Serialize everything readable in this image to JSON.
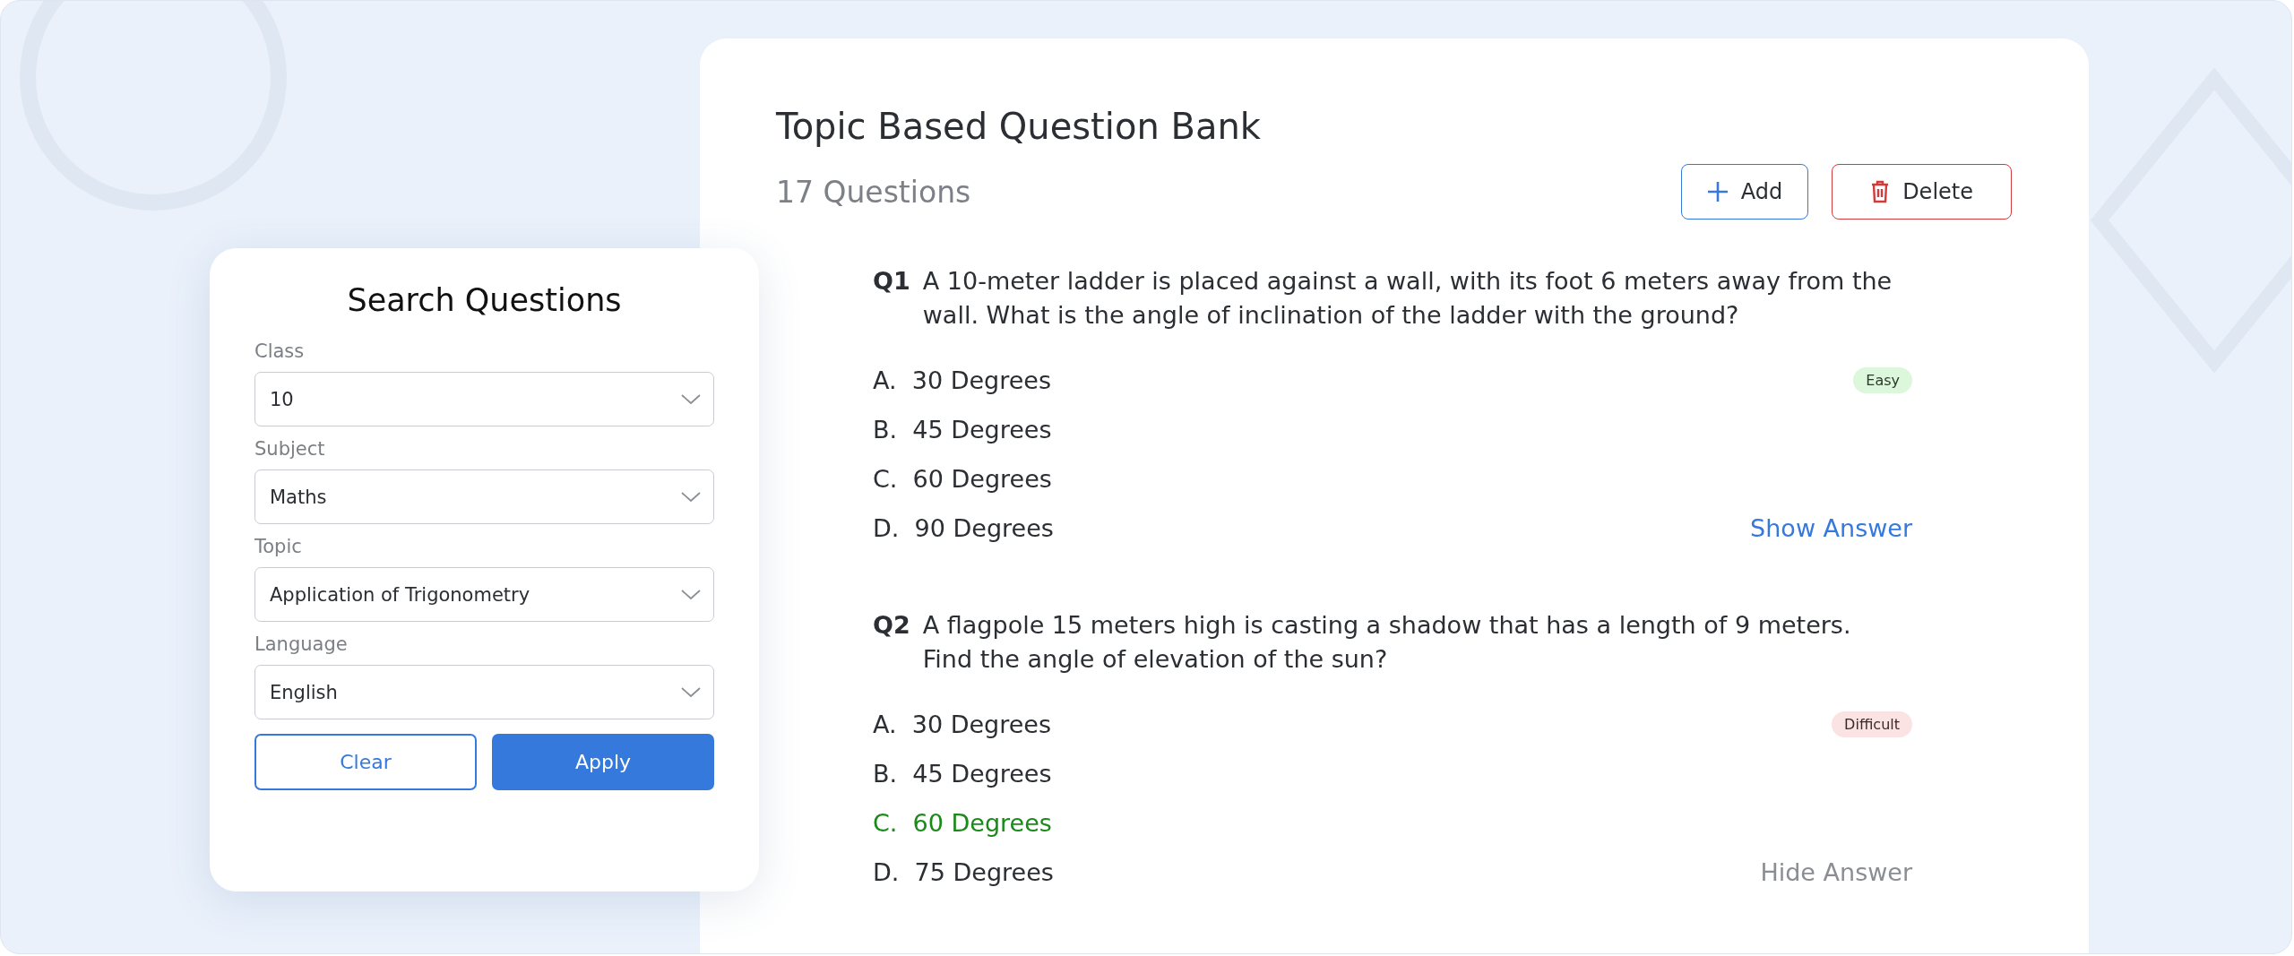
{
  "search_panel": {
    "title": "Search Questions",
    "fields": [
      {
        "label": "Class",
        "value": "10"
      },
      {
        "label": "Subject",
        "value": "Maths"
      },
      {
        "label": "Topic",
        "value": "Application of Trigonometry"
      },
      {
        "label": "Language",
        "value": "English"
      }
    ],
    "buttons": [
      {
        "label": "Clear",
        "kind": "outline"
      },
      {
        "label": "Apply",
        "kind": "primary"
      }
    ]
  },
  "bank": {
    "title": "Topic Based Question Bank",
    "count": "17 Questions",
    "actions": [
      {
        "label": "Add",
        "kind": "add"
      },
      {
        "label": "Delete",
        "kind": "delete"
      }
    ],
    "questions": [
      {
        "number": "Q1",
        "text": "A 10-meter ladder is placed against a wall, with its foot 6 meters away from the wall. What is the angle of inclination of the ladder with the ground?",
        "difficulty": {
          "label": "Easy",
          "kind": "easy"
        },
        "answer_visible": false,
        "toggle": "Show Answer",
        "options": [
          {
            "label": "A.  30 Degrees",
            "highlighted": false
          },
          {
            "label": "B.  45 Degrees",
            "highlighted": false
          },
          {
            "label": "C.  60 Degrees",
            "highlighted": false
          },
          {
            "label": "D.  90 Degrees",
            "highlighted": false
          }
        ]
      },
      {
        "number": "Q2",
        "text": "A flagpole 15 meters high is casting a shadow that has a length of 9 meters. Find the angle of elevation of the sun?",
        "difficulty": {
          "label": "Difficult",
          "kind": "difficult"
        },
        "answer_visible": true,
        "toggle": "Hide Answer",
        "options": [
          {
            "label": "A.  30 Degrees",
            "highlighted": false
          },
          {
            "label": "B.  45 Degrees",
            "highlighted": false
          },
          {
            "label": "C.  60 Degrees",
            "highlighted": true
          },
          {
            "label": "D.  75 Degrees",
            "highlighted": false
          }
        ]
      }
    ]
  }
}
